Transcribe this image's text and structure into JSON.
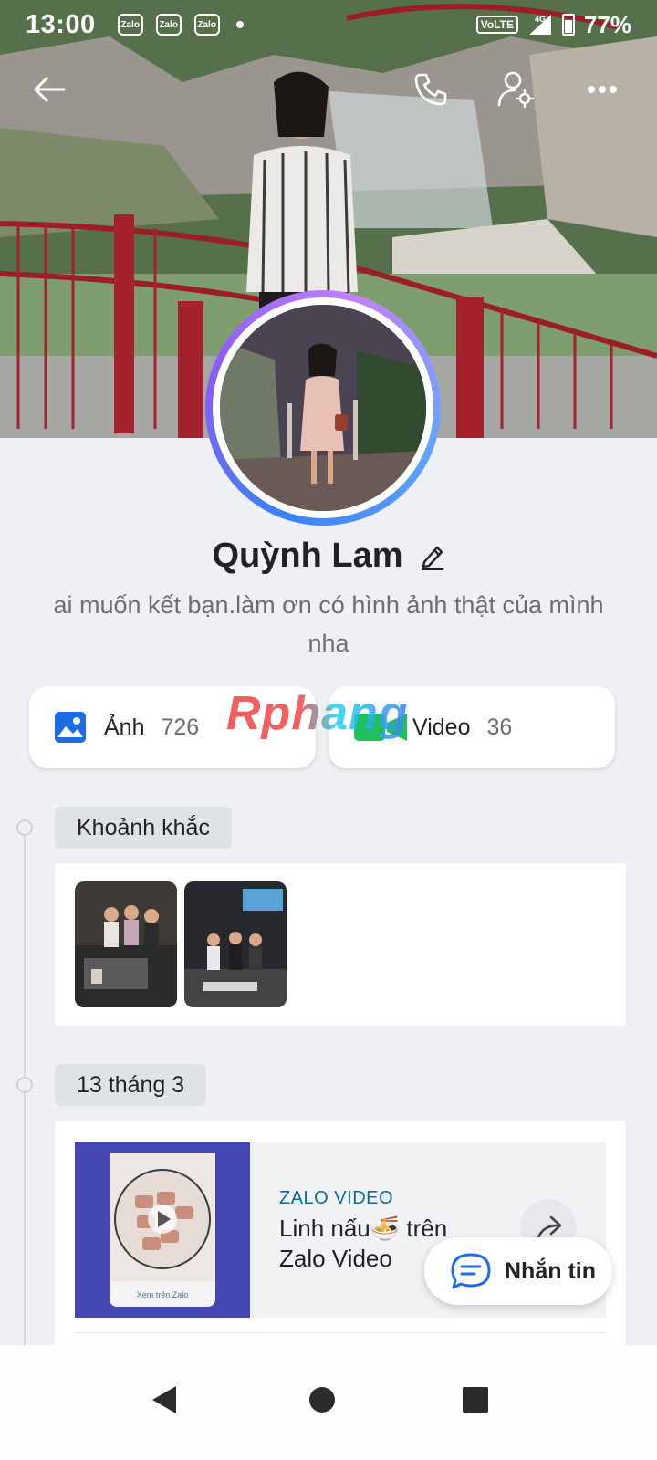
{
  "status_bar": {
    "time": "13:00",
    "notifications": [
      "Zalo",
      "Zalo",
      "Zalo"
    ],
    "network": "VoLTE",
    "signal_label": "4G",
    "battery": "77%"
  },
  "profile": {
    "name": "Quỳnh Lam",
    "bio": "ai muốn kết bạn.làm ơn có hình ảnh thật của mình nha"
  },
  "media": {
    "photos": {
      "label": "Ảnh",
      "count": "726"
    },
    "videos": {
      "label": "Video",
      "count": "36"
    }
  },
  "watermark": "Rphang",
  "timeline": {
    "moments_label": "Khoảnh khắc",
    "date_label": "13 tháng 3",
    "video_post": {
      "tag": "ZALO VIDEO",
      "title": "Linh nấu🍜 trên Zalo Video",
      "thumb_caption": "Xem trên Zalo"
    }
  },
  "message_button": {
    "label": "Nhắn tin"
  },
  "colors": {
    "accent_blue": "#1e6be6",
    "video_green": "#1fbf5a",
    "ring_start": "#3b82f6",
    "ring_end": "#c084fc"
  },
  "icons": [
    "back-arrow-icon",
    "phone-icon",
    "user-settings-icon",
    "more-icon",
    "edit-icon",
    "image-icon",
    "video-camera-icon",
    "share-icon",
    "chat-bubble-icon",
    "nav-back-icon",
    "nav-home-icon",
    "nav-recents-icon"
  ]
}
